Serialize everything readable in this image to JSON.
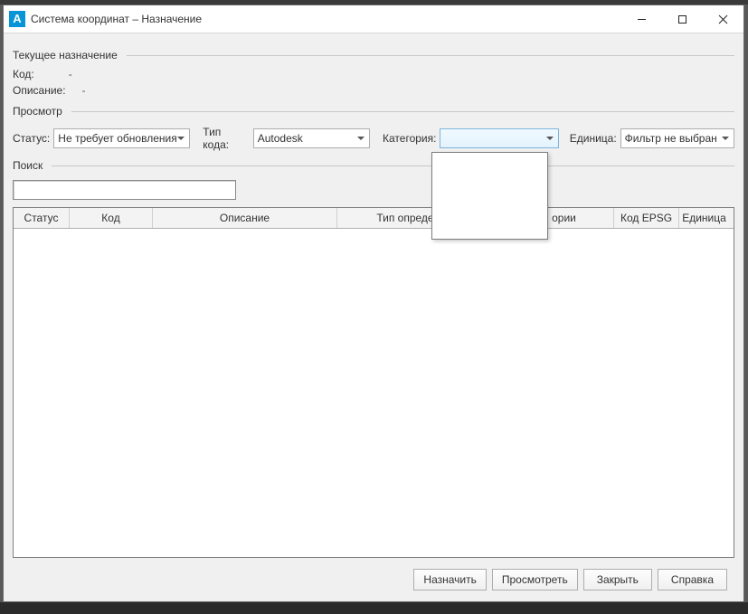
{
  "window": {
    "title": "Система координат – Назначение"
  },
  "group_current": {
    "label": "Текущее назначение",
    "code_label": "Код:",
    "code_value": "-",
    "desc_label": "Описание:",
    "desc_value": "-"
  },
  "group_view": {
    "label": "Просмотр",
    "status_label": "Статус:",
    "status_value": "Не требует обновления",
    "codetype_label": "Тип кода:",
    "codetype_value": "Autodesk",
    "category_label": "Категория:",
    "category_value": "",
    "unit_label": "Единица:",
    "unit_value": "Фильтр не выбран"
  },
  "group_search": {
    "label": "Поиск"
  },
  "columns": {
    "status": "Статус",
    "code": "Код",
    "description": "Описание",
    "deftype": "Тип определения С",
    "reference": "ории",
    "epsg": "Код EPSG",
    "unit": "Единица"
  },
  "buttons": {
    "assign": "Назначить",
    "preview": "Просмотреть",
    "close": "Закрыть",
    "help": "Справка"
  }
}
